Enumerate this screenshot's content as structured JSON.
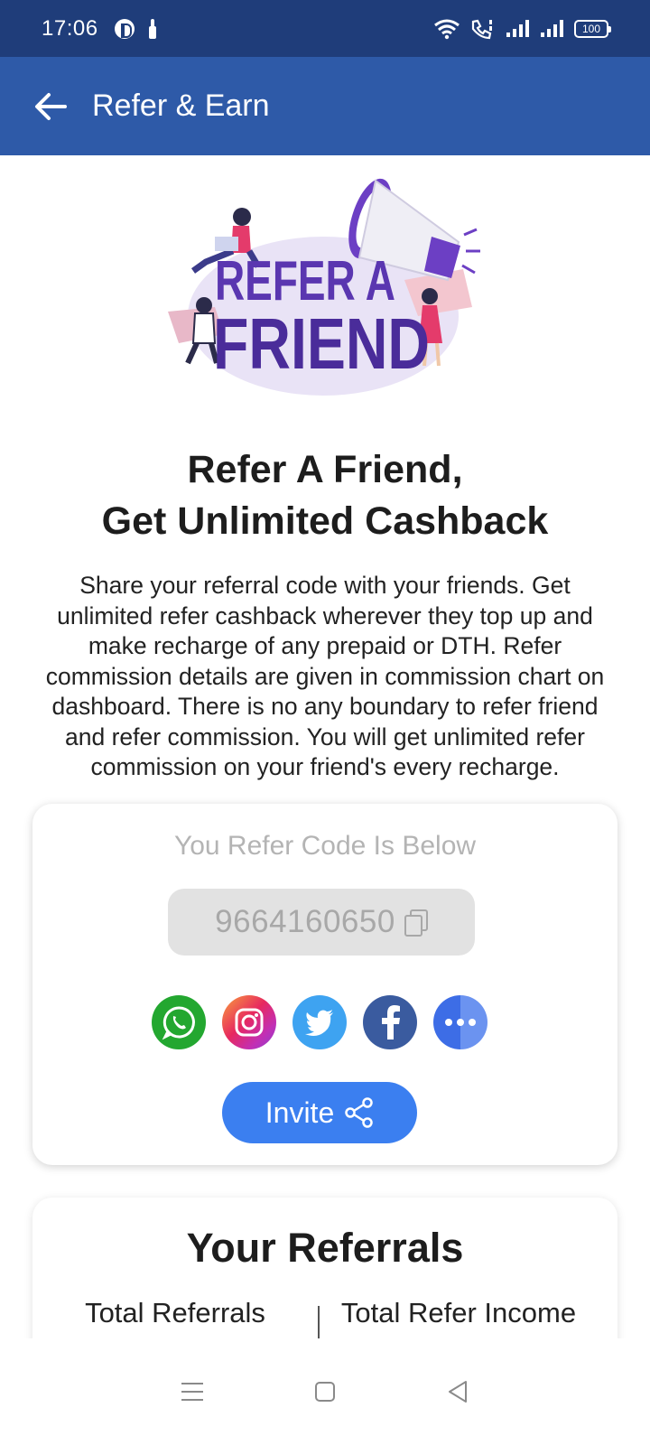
{
  "status_bar": {
    "time": "17:06",
    "battery": "100",
    "icons": [
      "app-icon",
      "drop-icon",
      "wifi-icon",
      "volte-icon",
      "signal-icon",
      "signal-icon",
      "battery-icon"
    ]
  },
  "app_bar": {
    "title": "Refer & Earn",
    "back_icon": "arrow-left-icon"
  },
  "hero": {
    "line1": "REFER A",
    "line2": "FRIEND"
  },
  "headline": {
    "line1": "Refer A Friend,",
    "line2": "Get Unlimited Cashback"
  },
  "description": "Share your referral code with your friends. Get unlimited refer cashback wherever they top up and make recharge of any prepaid or DTH. Refer commission details are given in commission chart on dashboard. There is no any boundary to refer friend and refer commission. You will get unlimited refer commission on your friend's every recharge.",
  "refer_card": {
    "label": "You Refer Code Is Below",
    "code": "9664160650",
    "social": [
      "whatsapp-icon",
      "instagram-icon",
      "twitter-icon",
      "facebook-icon",
      "more-icon"
    ],
    "invite_label": "Invite"
  },
  "referrals": {
    "title": "Your Referrals",
    "total_referrals_label": "Total Referrals",
    "total_income_label": "Total Refer Income"
  },
  "colors": {
    "status_bar": "#1f3d7a",
    "app_bar": "#2e5aa8",
    "invite_button": "#3b7ff0",
    "hero_purple": "#5a36b0"
  }
}
